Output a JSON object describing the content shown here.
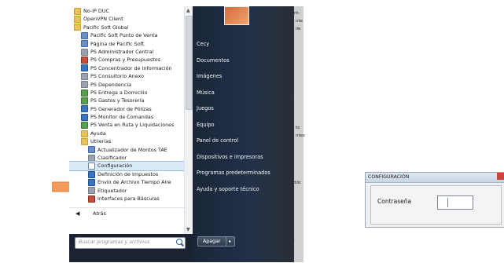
{
  "start_menu": {
    "programs": [
      {
        "label": "No-IP DUC",
        "level": 0,
        "icon": "folder"
      },
      {
        "label": "OpenVPN Client",
        "level": 0,
        "icon": "folder"
      },
      {
        "label": "Pacific Soft Global",
        "level": 0,
        "icon": "folder"
      },
      {
        "label": "Pacific Soft Punto de Venta",
        "level": 1,
        "icon": "app"
      },
      {
        "label": "Página de Pacific Soft",
        "level": 1,
        "icon": "app"
      },
      {
        "label": "PS Administrador Central",
        "level": 1,
        "icon": "ps"
      },
      {
        "label": "PS Compras y Presupuestos",
        "level": 1,
        "icon": "red"
      },
      {
        "label": "PS Concentrador de Información",
        "level": 1,
        "icon": "blue"
      },
      {
        "label": "PS Consultorio Anexo",
        "level": 1,
        "icon": "ps"
      },
      {
        "label": "PS Dependencia",
        "level": 1,
        "icon": "ps"
      },
      {
        "label": "PS Entrega a Domicilio",
        "level": 1,
        "icon": "green"
      },
      {
        "label": "PS Gastos y Tesorería",
        "level": 1,
        "icon": "green"
      },
      {
        "label": "PS Generador de Pólizas",
        "level": 1,
        "icon": "blue"
      },
      {
        "label": "PS Monitor de Comandas",
        "level": 1,
        "icon": "blue"
      },
      {
        "label": "PS Venta en Ruta y Liquidaciones",
        "level": 1,
        "icon": "green"
      },
      {
        "label": "Ayuda",
        "level": 1,
        "icon": "folder"
      },
      {
        "label": "Utilerías",
        "level": 1,
        "icon": "folder"
      },
      {
        "label": "Actualizador de Montos TAE",
        "level": 2,
        "icon": "app"
      },
      {
        "label": "Clasificador",
        "level": 2,
        "icon": "ps"
      },
      {
        "label": "Configuración",
        "level": 2,
        "icon": "cfg",
        "selected": true
      },
      {
        "label": "Definición de Impuestos",
        "level": 2,
        "icon": "blue"
      },
      {
        "label": "Envío de Archivo Tiempo Aire",
        "level": 2,
        "icon": "blue"
      },
      {
        "label": "Etiquetador",
        "level": 2,
        "icon": "ps"
      },
      {
        "label": "Interfaces para Básculas",
        "level": 2,
        "icon": "red"
      }
    ],
    "back_label": "Atrás",
    "search_placeholder": "Buscar programas y archivos",
    "right_links": [
      "Cecy",
      "Documentos",
      "Imágenes",
      "Música",
      "Juegos",
      "Equipo",
      "Panel de control",
      "Dispositivos e impresoras",
      "Programas predeterminados",
      "Ayuda y soporte técnico"
    ],
    "shutdown_label": "Apagar"
  },
  "desktop": {
    "fragments": [
      "ró-",
      "nte",
      "ile",
      "to",
      "ntes",
      "ddc",
      "112...",
      "ecto"
    ]
  },
  "dialog": {
    "title": "CONFIGURACIÓN",
    "password_label": "Contraseña",
    "password_value": ""
  },
  "colors": {
    "arrow": "#f29b5c",
    "selection": "#dbe9f9"
  }
}
